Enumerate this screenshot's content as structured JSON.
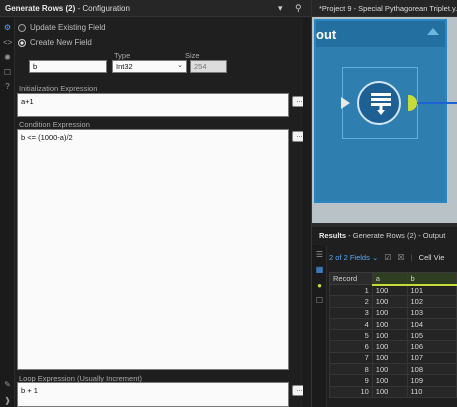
{
  "config": {
    "title_bold": "Generate Rows (2)",
    "title_suffix": " - Configuration",
    "radio_update": "Update Existing Field",
    "radio_create": "Create New  Field",
    "name_value": "b",
    "type_label": "Type",
    "type_value": "Int32",
    "size_label": "Size",
    "size_value": "254",
    "init_label": "Initialization Expression",
    "init_value": "a+1",
    "cond_label": "Condition Expression",
    "cond_value": "b <= (1000-a)/2",
    "loop_label": "Loop Expression (Usually Increment)",
    "loop_value": "b + 1",
    "ellipsis": "..."
  },
  "canvas": {
    "tab_title": "*Project 9 - Special Pythagorean Triplet.y...",
    "container_title": "out"
  },
  "results": {
    "title_bold": "Results",
    "title_suffix": " - Generate Rows (2) - Output",
    "fields_label": "2 of 2 Fields",
    "cell_view": "Cell Vie",
    "columns": [
      "Record",
      "a",
      "b"
    ],
    "rows": [
      [
        "1",
        "100",
        "101"
      ],
      [
        "2",
        "100",
        "102"
      ],
      [
        "3",
        "100",
        "103"
      ],
      [
        "4",
        "100",
        "104"
      ],
      [
        "5",
        "100",
        "105"
      ],
      [
        "6",
        "100",
        "106"
      ],
      [
        "7",
        "100",
        "107"
      ],
      [
        "8",
        "100",
        "108"
      ],
      [
        "9",
        "100",
        "109"
      ],
      [
        "10",
        "100",
        "110"
      ]
    ]
  },
  "colors": {
    "accent": "#4aa3ff",
    "container": "#236fa0",
    "output_anchor": "#c5dc3a"
  }
}
